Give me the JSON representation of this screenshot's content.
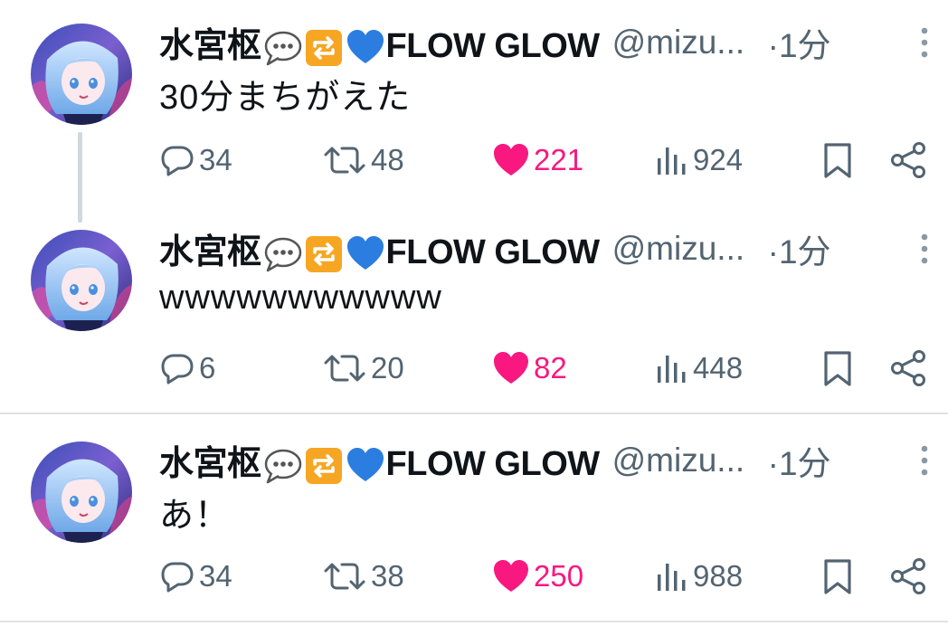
{
  "colors": {
    "text": "#0f1419",
    "secondary": "#536471",
    "like": "#f91880",
    "divider": "#dfe3e6",
    "thread_line": "#cfd9de"
  },
  "tweets": [
    {
      "author": {
        "name_prefix": "水宮枢",
        "name_suffix": "FLOW GLOW",
        "handle": "@mizu...",
        "badges": [
          "speech-balloon-emoji",
          "repeat-emoji",
          "blue-heart-emoji"
        ]
      },
      "time": "·1分",
      "text": "30分まちがえた",
      "metrics": {
        "replies": "34",
        "reposts": "48",
        "likes": "221",
        "views": "924"
      },
      "liked": true
    },
    {
      "author": {
        "name_prefix": "水宮枢",
        "name_suffix": "FLOW GLOW",
        "handle": "@mizu...",
        "badges": [
          "speech-balloon-emoji",
          "repeat-emoji",
          "blue-heart-emoji"
        ]
      },
      "time": "·1分",
      "text": "wwwwwwwwwww",
      "metrics": {
        "replies": "6",
        "reposts": "20",
        "likes": "82",
        "views": "448"
      },
      "liked": true
    },
    {
      "author": {
        "name_prefix": "水宮枢",
        "name_suffix": "FLOW GLOW",
        "handle": "@mizu...",
        "badges": [
          "speech-balloon-emoji",
          "repeat-emoji",
          "blue-heart-emoji"
        ]
      },
      "time": "·1分",
      "text": "あ！",
      "metrics": {
        "replies": "34",
        "reposts": "38",
        "likes": "250",
        "views": "988"
      },
      "liked": true
    }
  ]
}
